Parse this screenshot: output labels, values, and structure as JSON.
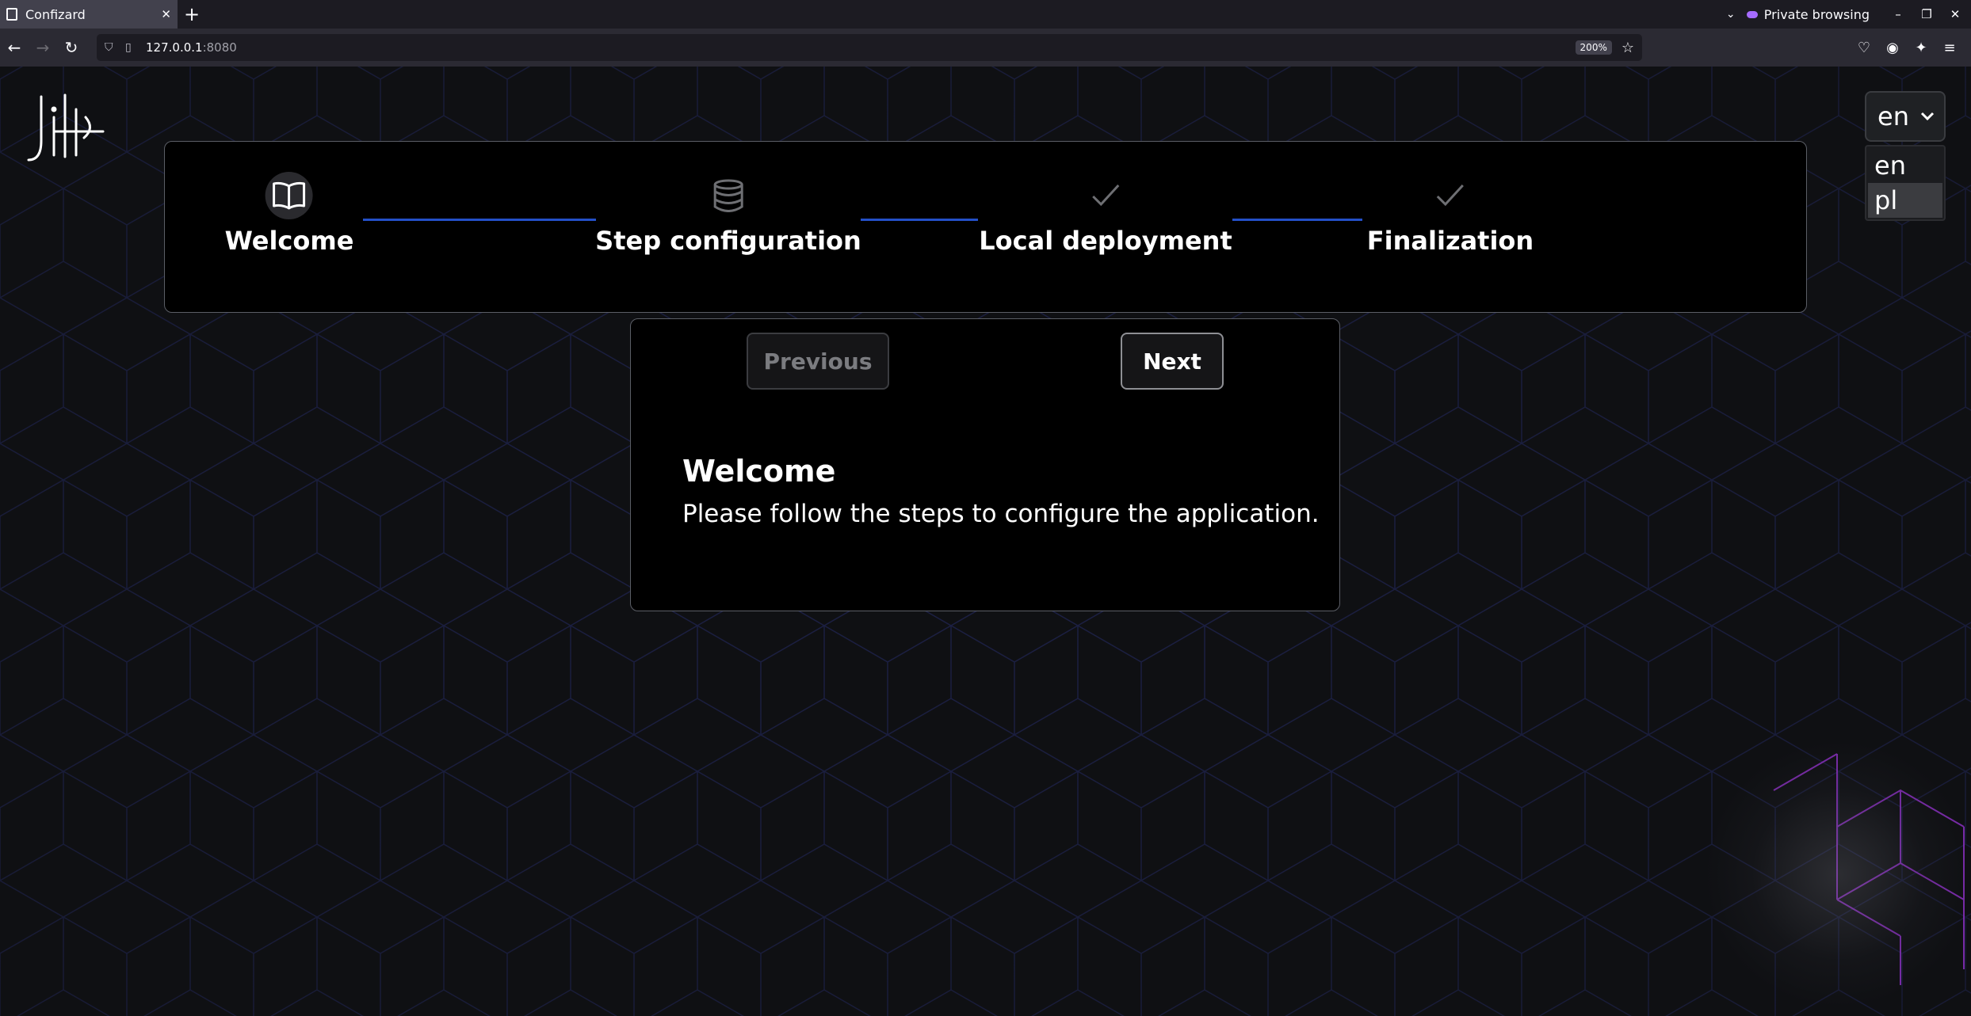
{
  "browser": {
    "tab_title": "Confizard",
    "private_label": "Private browsing",
    "url_host": "127.0.0.1",
    "url_port": ":8080",
    "zoom": "200%"
  },
  "stepper": {
    "steps": [
      {
        "label": "Welcome",
        "icon": "book-icon",
        "active": true
      },
      {
        "label": "Step configuration",
        "icon": "database-icon",
        "active": false
      },
      {
        "label": "Local deployment",
        "icon": "check-icon",
        "active": false
      },
      {
        "label": "Finalization",
        "icon": "check-icon",
        "active": false
      }
    ]
  },
  "nav": {
    "previous_label": "Previous",
    "next_label": "Next"
  },
  "content": {
    "title": "Welcome",
    "description": "Please follow the steps to configure the application."
  },
  "language": {
    "selected": "en",
    "options": [
      "en",
      "pl"
    ],
    "highlighted": "pl"
  },
  "colors": {
    "accent": "#2450c8",
    "glow": "#9b3bd4"
  }
}
